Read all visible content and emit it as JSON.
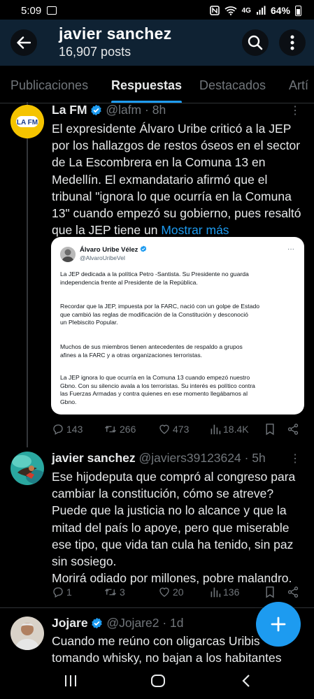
{
  "status_bar": {
    "time": "5:09",
    "battery": "64%",
    "network": "4G"
  },
  "header": {
    "title": "javier sanchez",
    "subtitle": "16,907 posts"
  },
  "tabs": [
    {
      "label": "Publicaciones",
      "active": false
    },
    {
      "label": "Respuestas",
      "active": true
    },
    {
      "label": "Destacados",
      "active": false
    },
    {
      "label": "Artí",
      "active": false
    }
  ],
  "tweets": [
    {
      "name": "La FM",
      "verified": true,
      "handle": "@lafm",
      "time": "· 8h",
      "avatar_text": "LA FM",
      "lines": [
        "El expresidente Álvaro Uribe criticó a la JEP",
        "por los hallazgos de restos óseos en el sector",
        "de La Escombrera en la Comuna 13 en",
        "Medellín. El exmandatario afirmó que el",
        "tribunal \"ignora lo que ocurría en la Comuna",
        "13\" cuando empezó su gobierno, pues resaltó"
      ],
      "last_line": "que la JEP tiene un ",
      "show_more": "Mostrar más",
      "card": {
        "name": "Álvaro Uribe Vélez",
        "handle": "@AlvaroUribeVel",
        "paragraphs": [
          [
            "La JEP dedicada a la política Petro -Santista. Su Presidente no guarda",
            "independencia frente al Presidente de la República."
          ],
          [
            "Recordar que la JEP, impuesta por la FARC, nació con un golpe de Estado",
            "que cambió las reglas de modificación de la  Constitución y desconoció",
            "un Plebiscito Popular."
          ],
          [
            "Muchos de sus miembros tienen antecedentes de respaldo a grupos",
            "afines a la FARC y a otras organizaciones terroristas."
          ],
          [
            "La JEP ignora lo que ocurría en la Comuna 13 cuando empezó nuestro",
            "Gbno. Con su silencio avala a los terroristas. Su interés es político contra",
            "las Fuerzas Armadas y contra quienes en ese momento llegábamos al",
            "Gbno."
          ]
        ]
      },
      "stats": {
        "replies": "143",
        "reposts": "266",
        "likes": "473",
        "views": "18.4K"
      }
    },
    {
      "name": "javier sanchez",
      "handle": "@javiers39123624",
      "time": "· 5h",
      "lines": [
        "Ese hijodeputa que compró al congreso para",
        "cambiar la constitución, cómo se atreve?",
        "Puede que la justicia no lo alcance y que la",
        "mitad del país lo apoye, pero que miserable",
        "ese tipo, que vida tan cula ha tenido, sin paz",
        "sin sosiego.",
        "Morirá odiado por millones, pobre malandro."
      ],
      "stats": {
        "replies": "1",
        "reposts": "3",
        "likes": "20",
        "views": "136"
      }
    },
    {
      "name": "Jojare",
      "verified": true,
      "handle": "@Jojare2",
      "time": "· 1d",
      "lines": [
        "Cuando me reúno con oligarcas Uribis",
        "tomando whisky, no bajan a los habitantes"
      ]
    }
  ],
  "colors": {
    "accent": "#1d9bf0",
    "header_bg": "#0f2233",
    "muted": "#71767b",
    "lafm_yellow": "#f5c400"
  }
}
